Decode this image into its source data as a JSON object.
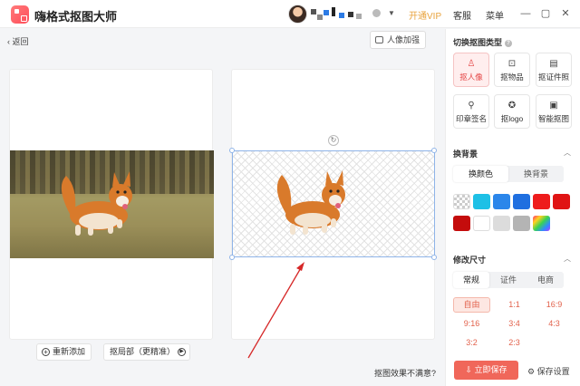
{
  "app": {
    "title": "嗨格式抠图大师"
  },
  "header": {
    "vip": "开通VIP",
    "service": "客服",
    "menu": "菜单",
    "minimize": "—",
    "restore": "▢",
    "close": "✕"
  },
  "toolbar": {
    "back": "返回",
    "portrait_enhance": "人像加强"
  },
  "canvas": {
    "add_new": "重新添加",
    "partial_cutout": "抠局部（更精准）",
    "unsatisfied": "抠图效果不满意?"
  },
  "cutout_type": {
    "title": "切换抠图类型",
    "items": [
      {
        "label": "抠人像",
        "icon": "person-icon"
      },
      {
        "label": "抠物品",
        "icon": "box-icon"
      },
      {
        "label": "抠证件照",
        "icon": "id-card-icon"
      },
      {
        "label": "印章签名",
        "icon": "stamp-icon"
      },
      {
        "label": "抠logo",
        "icon": "badge-icon"
      },
      {
        "label": "智能抠图",
        "icon": "ai-icon"
      }
    ]
  },
  "background": {
    "title": "换背景",
    "tabs": [
      "换颜色",
      "换背景"
    ],
    "swatches": [
      "transparent",
      "#1ec0e6",
      "#2b86ea",
      "#1f6fe0",
      "#ee1c1c",
      "#e01414",
      "#c40c0c",
      "#ffffff",
      "#dcdcdc",
      "#b4b4b4",
      "rainbow"
    ]
  },
  "size": {
    "title": "修改尺寸",
    "tabs": [
      "常规",
      "证件",
      "电商"
    ],
    "ratios": [
      "自由",
      "1:1",
      "16:9",
      "9:16",
      "3:4",
      "4:3",
      "3:2",
      "2:3"
    ]
  },
  "footer": {
    "save_now": "立即保存",
    "save_settings": "保存设置"
  },
  "colors": {
    "accent": "#f0675a",
    "vip": "#e8a33d"
  }
}
